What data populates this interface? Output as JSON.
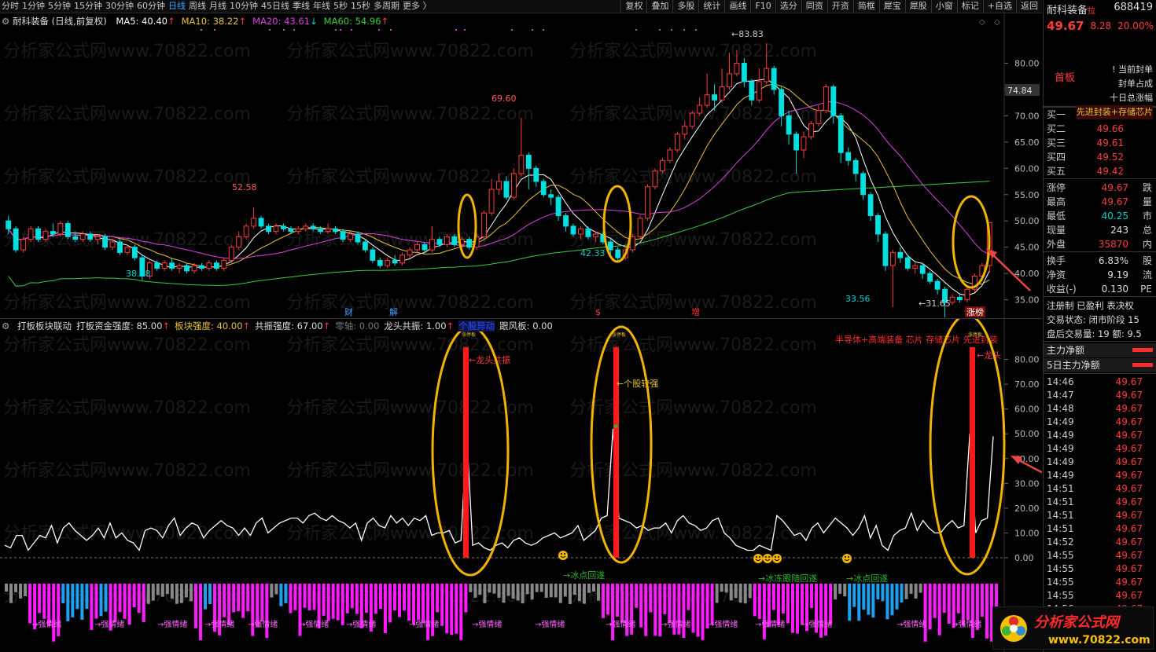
{
  "toolbar": {
    "periods": [
      "分时",
      "1分钟",
      "5分钟",
      "15分钟",
      "30分钟",
      "60分钟",
      "日线",
      "周线",
      "月线",
      "10分钟",
      "45日线",
      "季线",
      "年线",
      "5秒",
      "15秒",
      "多周期",
      "更多 〉"
    ],
    "active_period": "日线",
    "tools": [
      "复权",
      "叠加",
      "多股",
      "统计",
      "画线",
      "F10",
      "选分",
      "同资",
      "开资",
      "简框",
      "犀宝",
      "犀股",
      "小窗",
      "标记",
      "+自选",
      "返回"
    ]
  },
  "price_chart": {
    "stock_label": "耐科装备 (日线,前复权)",
    "ma": [
      {
        "label": "MA5: 40.40",
        "arrow": "↑",
        "color": "#ffffff"
      },
      {
        "label": "MA10: 38.22",
        "arrow": "↑",
        "color": "#e8c23a"
      },
      {
        "label": "MA20: 43.61",
        "arrow": "↓",
        "color": "#e040e0"
      },
      {
        "label": "MA60: 54.96",
        "arrow": "↑",
        "color": "#3ccd3c"
      }
    ],
    "y_ticks": [
      "80.00",
      "75.00",
      "70.00",
      "65.00",
      "60.00",
      "55.00",
      "50.00",
      "45.00",
      "40.00",
      "35.00"
    ],
    "y_range": [
      33,
      85
    ],
    "cursor_price": "74.84",
    "annotations": [
      "83.83",
      "69.60",
      "52.58",
      "38.68",
      "42.33",
      "33.56",
      "31.65"
    ],
    "event_markers": [
      "财",
      "解",
      "$",
      "增",
      "涨榜"
    ]
  },
  "oscillator": {
    "header": [
      {
        "label": "打板板块联动",
        "color": "#dddddd"
      },
      {
        "label": "打板资金强度: 85.00",
        "arrow": "↑",
        "color": "#dddddd"
      },
      {
        "label": "板块强度: 40.00",
        "arrow": "↑",
        "color": "#e8c23a"
      },
      {
        "label": "共振强度: 67.00",
        "arrow": "↑",
        "color": "#dddddd"
      },
      {
        "label": "零轴: 0.00",
        "color": "#777777"
      },
      {
        "label": "龙头共振: 1.00",
        "arrow": "↑",
        "color": "#dddddd"
      },
      {
        "label": "个股异动",
        "color": "#2a4bff"
      },
      {
        "label": "跟风板: 0.00",
        "color": "#dddddd"
      }
    ],
    "y_ticks": [
      "80.00",
      "70.00",
      "60.00",
      "50.00",
      "40.00",
      "30.00",
      "20.00",
      "10.00",
      "0.00"
    ],
    "y_range": [
      0,
      90
    ],
    "labels": {
      "dragon": "←龙头共振",
      "stock_strong": "←个股较强",
      "ice1": "→冰点回遂",
      "ice2": "→冰冻跟随回遂",
      "ice3": "→冰点回遂",
      "sector_tag": "半导体+高端装备 芯片 存储芯片 先进封装",
      "right_dragon": "←龙头",
      "emotion": "强情绪",
      "top_tag": "涨停板"
    }
  },
  "quote": {
    "name": "耐科装备",
    "badge": "拉",
    "code": "688419",
    "price": "49.67",
    "change": "8.28",
    "pct": "20.00%",
    "tag_board": "首板",
    "tag_lines": [
      "! 当前封单",
      "封单占成",
      "十日总涨幅",
      "先进封装+存储芯片"
    ],
    "bids": [
      {
        "k": "买一",
        "v": "49.67"
      },
      {
        "k": "买二",
        "v": "49.66"
      },
      {
        "k": "买三",
        "v": "49.61"
      },
      {
        "k": "买四",
        "v": "49.52"
      },
      {
        "k": "买五",
        "v": "49.42"
      }
    ],
    "stats": [
      {
        "k": "涨停",
        "v": "49.67",
        "e": "跌",
        "c": "#ff3b3b"
      },
      {
        "k": "最高",
        "v": "49.67",
        "e": "量",
        "c": "#ff3b3b"
      },
      {
        "k": "最低",
        "v": "40.25",
        "e": "市",
        "c": "#00d2d2"
      },
      {
        "k": "现量",
        "v": "243",
        "e": "总",
        "c": "#dddddd"
      },
      {
        "k": "外盘",
        "v": "35870",
        "e": "内",
        "c": "#ff3b3b"
      }
    ],
    "stats2": [
      {
        "k": "换手",
        "v": "6.83%",
        "e": "股",
        "c": "#dddddd"
      },
      {
        "k": "净资",
        "v": "9.19",
        "e": "流",
        "c": "#dddddd"
      },
      {
        "k": "收益(-)",
        "v": "0.130",
        "e": "PE",
        "c": "#dddddd"
      }
    ],
    "info": [
      "注册制  已盈利  表决权",
      "交易状态: 闭市阶段 15",
      "盘后交易量: 19  额: 9.5"
    ],
    "flow": [
      "主力净额",
      "5日主力净额"
    ],
    "ticks": [
      {
        "t": "14:46",
        "p": "49.67"
      },
      {
        "t": "14:47",
        "p": "49.67"
      },
      {
        "t": "14:48",
        "p": "49.67"
      },
      {
        "t": "14:49",
        "p": "49.67"
      },
      {
        "t": "14:49",
        "p": "49.67"
      },
      {
        "t": "14:49",
        "p": "49.67"
      },
      {
        "t": "14:49",
        "p": "49.67"
      },
      {
        "t": "14:49",
        "p": "49.67"
      },
      {
        "t": "14:51",
        "p": "49.67"
      },
      {
        "t": "14:51",
        "p": "49.67"
      },
      {
        "t": "14:51",
        "p": "49.67"
      },
      {
        "t": "14:51",
        "p": "49.67"
      },
      {
        "t": "14:52",
        "p": "49.67"
      },
      {
        "t": "14:55",
        "p": "49.67"
      },
      {
        "t": "14:55",
        "p": "49.67"
      },
      {
        "t": "14:55",
        "p": "49.67"
      },
      {
        "t": "14:55",
        "p": "49.67"
      },
      {
        "t": "14:56",
        "p": "49.67"
      }
    ]
  },
  "watermark": "分析家公式网www.70822.com",
  "brand": {
    "name": "分析家公式网",
    "url": "www.70822.com"
  },
  "chart_data": {
    "type": "candlestick",
    "y_range": [
      33,
      85
    ],
    "candles": [
      [
        50.0,
        48.5,
        51.0,
        47.5
      ],
      [
        48.5,
        44.5,
        49.0,
        44.0
      ],
      [
        44.5,
        46.5,
        47.0,
        44.0
      ],
      [
        46.5,
        48.5,
        49.0,
        46.0
      ],
      [
        48.5,
        46.5,
        49.0,
        46.0
      ],
      [
        46.5,
        48.0,
        48.5,
        46.0
      ],
      [
        48.0,
        47.5,
        49.5,
        47.0
      ],
      [
        47.5,
        49.5,
        50.0,
        47.0
      ],
      [
        49.5,
        47.0,
        50.0,
        46.5
      ],
      [
        47.0,
        46.5,
        48.0,
        46.0
      ],
      [
        46.5,
        47.5,
        48.0,
        46.0
      ],
      [
        47.5,
        46.5,
        48.0,
        46.0
      ],
      [
        46.5,
        47.0,
        47.5,
        45.5
      ],
      [
        47.0,
        45.0,
        47.5,
        44.5
      ],
      [
        45.0,
        46.0,
        46.5,
        44.5
      ],
      [
        46.0,
        44.0,
        46.5,
        43.5
      ],
      [
        44.0,
        45.0,
        45.5,
        43.5
      ],
      [
        45.0,
        43.0,
        45.5,
        42.5
      ],
      [
        43.0,
        39.5,
        43.5,
        38.7
      ],
      [
        39.5,
        42.0,
        42.5,
        39.0
      ],
      [
        42.0,
        41.0,
        42.5,
        40.5
      ],
      [
        41.0,
        42.0,
        42.5,
        40.5
      ],
      [
        42.0,
        41.0,
        43.0,
        40.5
      ],
      [
        41.0,
        41.5,
        42.0,
        40.0
      ],
      [
        41.5,
        40.5,
        42.0,
        40.0
      ],
      [
        40.5,
        41.5,
        42.0,
        40.0
      ],
      [
        41.5,
        41.0,
        42.0,
        40.5
      ],
      [
        41.0,
        42.0,
        42.5,
        40.5
      ],
      [
        42.0,
        41.0,
        42.5,
        40.5
      ],
      [
        41.0,
        42.5,
        43.0,
        40.5
      ],
      [
        42.5,
        45.0,
        45.5,
        42.0
      ],
      [
        45.0,
        47.0,
        48.0,
        44.5
      ],
      [
        47.0,
        49.0,
        49.5,
        46.5
      ],
      [
        49.0,
        50.5,
        52.6,
        48.5
      ],
      [
        50.5,
        49.0,
        51.0,
        48.5
      ],
      [
        49.0,
        48.0,
        49.5,
        47.5
      ],
      [
        48.0,
        49.0,
        49.5,
        47.5
      ],
      [
        49.0,
        48.5,
        49.5,
        48.0
      ],
      [
        48.5,
        48.0,
        49.0,
        47.5
      ],
      [
        48.0,
        48.5,
        49.0,
        47.5
      ],
      [
        48.5,
        49.0,
        49.5,
        48.0
      ],
      [
        49.0,
        48.5,
        49.5,
        48.0
      ],
      [
        48.5,
        48.0,
        49.0,
        47.5
      ],
      [
        48.0,
        48.5,
        49.5,
        47.5
      ],
      [
        48.5,
        48.0,
        49.0,
        47.5
      ],
      [
        48.0,
        46.5,
        48.5,
        46.0
      ],
      [
        46.5,
        47.5,
        48.0,
        46.0
      ],
      [
        47.5,
        46.0,
        48.0,
        45.5
      ],
      [
        46.0,
        44.5,
        46.5,
        44.0
      ],
      [
        44.5,
        42.5,
        45.0,
        42.0
      ],
      [
        42.5,
        41.5,
        43.0,
        41.0
      ],
      [
        41.5,
        42.5,
        43.0,
        41.0
      ],
      [
        42.5,
        42.0,
        43.5,
        41.5
      ],
      [
        42.0,
        43.5,
        44.0,
        41.5
      ],
      [
        43.5,
        44.5,
        45.0,
        43.0
      ],
      [
        44.5,
        45.5,
        46.0,
        44.0
      ],
      [
        45.5,
        44.5,
        46.0,
        44.0
      ],
      [
        44.5,
        46.5,
        49.0,
        44.0
      ],
      [
        46.5,
        45.5,
        47.0,
        45.0
      ],
      [
        45.5,
        47.0,
        47.5,
        45.0
      ],
      [
        47.0,
        45.5,
        47.5,
        45.0
      ],
      [
        45.5,
        46.5,
        47.0,
        45.0
      ],
      [
        46.5,
        45.0,
        47.0,
        44.5
      ],
      [
        45.0,
        47.0,
        47.5,
        44.5
      ],
      [
        47.0,
        51.5,
        52.0,
        46.5
      ],
      [
        51.5,
        56.0,
        58.0,
        51.0
      ],
      [
        56.0,
        57.5,
        59.0,
        55.0
      ],
      [
        57.5,
        54.5,
        58.5,
        54.0
      ],
      [
        54.5,
        59.0,
        60.0,
        54.0
      ],
      [
        59.0,
        62.5,
        69.6,
        58.5
      ],
      [
        62.5,
        60.0,
        63.0,
        56.0
      ],
      [
        60.0,
        57.5,
        60.5,
        56.5
      ],
      [
        57.5,
        55.0,
        58.0,
        54.5
      ],
      [
        55.0,
        54.5,
        56.0,
        53.0
      ],
      [
        54.5,
        51.0,
        55.0,
        50.0
      ],
      [
        51.0,
        49.0,
        51.5,
        48.0
      ],
      [
        49.0,
        47.5,
        49.5,
        47.0
      ],
      [
        47.5,
        48.5,
        49.0,
        46.5
      ],
      [
        48.5,
        47.0,
        49.0,
        46.5
      ],
      [
        47.0,
        47.5,
        48.0,
        46.0
      ],
      [
        47.5,
        46.0,
        48.0,
        45.5
      ],
      [
        46.0,
        44.5,
        46.5,
        43.5
      ],
      [
        44.5,
        43.0,
        45.0,
        42.3
      ],
      [
        43.0,
        44.5,
        45.0,
        42.5
      ],
      [
        44.5,
        47.0,
        47.5,
        44.0
      ],
      [
        47.0,
        50.5,
        51.0,
        46.5
      ],
      [
        50.5,
        56.5,
        57.0,
        50.0
      ],
      [
        56.5,
        59.5,
        60.0,
        56.0
      ],
      [
        59.5,
        61.5,
        62.0,
        59.0
      ],
      [
        61.5,
        63.5,
        64.0,
        61.0
      ],
      [
        63.5,
        66.5,
        67.0,
        63.0
      ],
      [
        66.5,
        68.0,
        69.0,
        65.5
      ],
      [
        68.0,
        70.5,
        71.0,
        67.5
      ],
      [
        70.5,
        72.0,
        73.5,
        70.0
      ],
      [
        72.0,
        74.0,
        78.0,
        71.5
      ],
      [
        74.0,
        73.0,
        76.0,
        71.0
      ],
      [
        73.0,
        75.5,
        79.0,
        72.5
      ],
      [
        75.5,
        78.0,
        82.0,
        75.0
      ],
      [
        78.0,
        80.0,
        82.5,
        77.5
      ],
      [
        80.0,
        76.5,
        81.0,
        75.5
      ],
      [
        76.5,
        73.0,
        77.0,
        72.0
      ],
      [
        73.0,
        76.5,
        79.0,
        72.5
      ],
      [
        76.5,
        79.0,
        83.8,
        76.0
      ],
      [
        79.0,
        75.0,
        79.5,
        74.0
      ],
      [
        75.0,
        70.0,
        75.5,
        68.0
      ],
      [
        70.0,
        66.5,
        71.0,
        64.5
      ],
      [
        66.5,
        63.5,
        67.0,
        59.0
      ],
      [
        63.5,
        66.0,
        67.0,
        62.0
      ],
      [
        66.0,
        68.5,
        69.0,
        65.5
      ],
      [
        68.5,
        71.0,
        72.0,
        68.0
      ],
      [
        71.0,
        75.5,
        76.0,
        70.5
      ],
      [
        75.5,
        70.0,
        76.0,
        68.5
      ],
      [
        70.0,
        63.0,
        70.5,
        61.0
      ],
      [
        63.0,
        61.5,
        64.0,
        60.5
      ],
      [
        61.5,
        59.0,
        62.0,
        57.5
      ],
      [
        59.0,
        55.0,
        59.5,
        54.0
      ],
      [
        55.0,
        51.0,
        55.5,
        50.0
      ],
      [
        51.0,
        47.5,
        51.5,
        46.0
      ],
      [
        47.5,
        41.5,
        48.0,
        40.5
      ],
      [
        41.5,
        44.0,
        44.5,
        33.6
      ],
      [
        44.0,
        43.0,
        45.0,
        42.0
      ],
      [
        43.0,
        41.0,
        43.5,
        40.5
      ],
      [
        41.0,
        41.5,
        42.0,
        40.0
      ],
      [
        41.5,
        40.0,
        42.0,
        39.0
      ],
      [
        40.0,
        38.5,
        40.5,
        38.0
      ],
      [
        38.5,
        37.0,
        39.0,
        36.0
      ],
      [
        37.0,
        34.5,
        37.5,
        31.65
      ],
      [
        34.5,
        35.5,
        36.0,
        34.0
      ],
      [
        35.5,
        35.0,
        36.0,
        34.5
      ],
      [
        35.0,
        37.0,
        37.5,
        34.5
      ],
      [
        37.0,
        39.5,
        40.0,
        36.5
      ],
      [
        39.5,
        41.5,
        42.0,
        39.0
      ],
      [
        41.5,
        49.67,
        49.67,
        40.25
      ]
    ],
    "osc_white": [
      5,
      4,
      9,
      9,
      3,
      6,
      9,
      8,
      13,
      6,
      12,
      14,
      11,
      9,
      7,
      9,
      12,
      8,
      14,
      8,
      10,
      7,
      6,
      3,
      11,
      12,
      11,
      8,
      13,
      16,
      9,
      12,
      14,
      13,
      8,
      11,
      13,
      15,
      13,
      12,
      9,
      12,
      9,
      14,
      16,
      10,
      12,
      14,
      15,
      16,
      16,
      14,
      17,
      18,
      16,
      15,
      17,
      15,
      14,
      12,
      14,
      7,
      14,
      16,
      13,
      12,
      17,
      14,
      16,
      13,
      16,
      15,
      17,
      9,
      10,
      10,
      11,
      6,
      7,
      8,
      5,
      6,
      4,
      3,
      5,
      6,
      4,
      7,
      8,
      6,
      5,
      6,
      8,
      9,
      10,
      8,
      9,
      10,
      13,
      7,
      9,
      11,
      16,
      17,
      15,
      16,
      15,
      14,
      12,
      13,
      11,
      12,
      12,
      14,
      10,
      15,
      17,
      14,
      13,
      11,
      12,
      15,
      16,
      10,
      8,
      5,
      4,
      3,
      3,
      5,
      4,
      3,
      17,
      15,
      12,
      9,
      10,
      7,
      12,
      14,
      10,
      13,
      16,
      14,
      12,
      9,
      12,
      17,
      8,
      13,
      5,
      3,
      9,
      11,
      12,
      18,
      11,
      15,
      12,
      10,
      10,
      13,
      15,
      12,
      13,
      10,
      10,
      15,
      16,
      49
    ]
  }
}
